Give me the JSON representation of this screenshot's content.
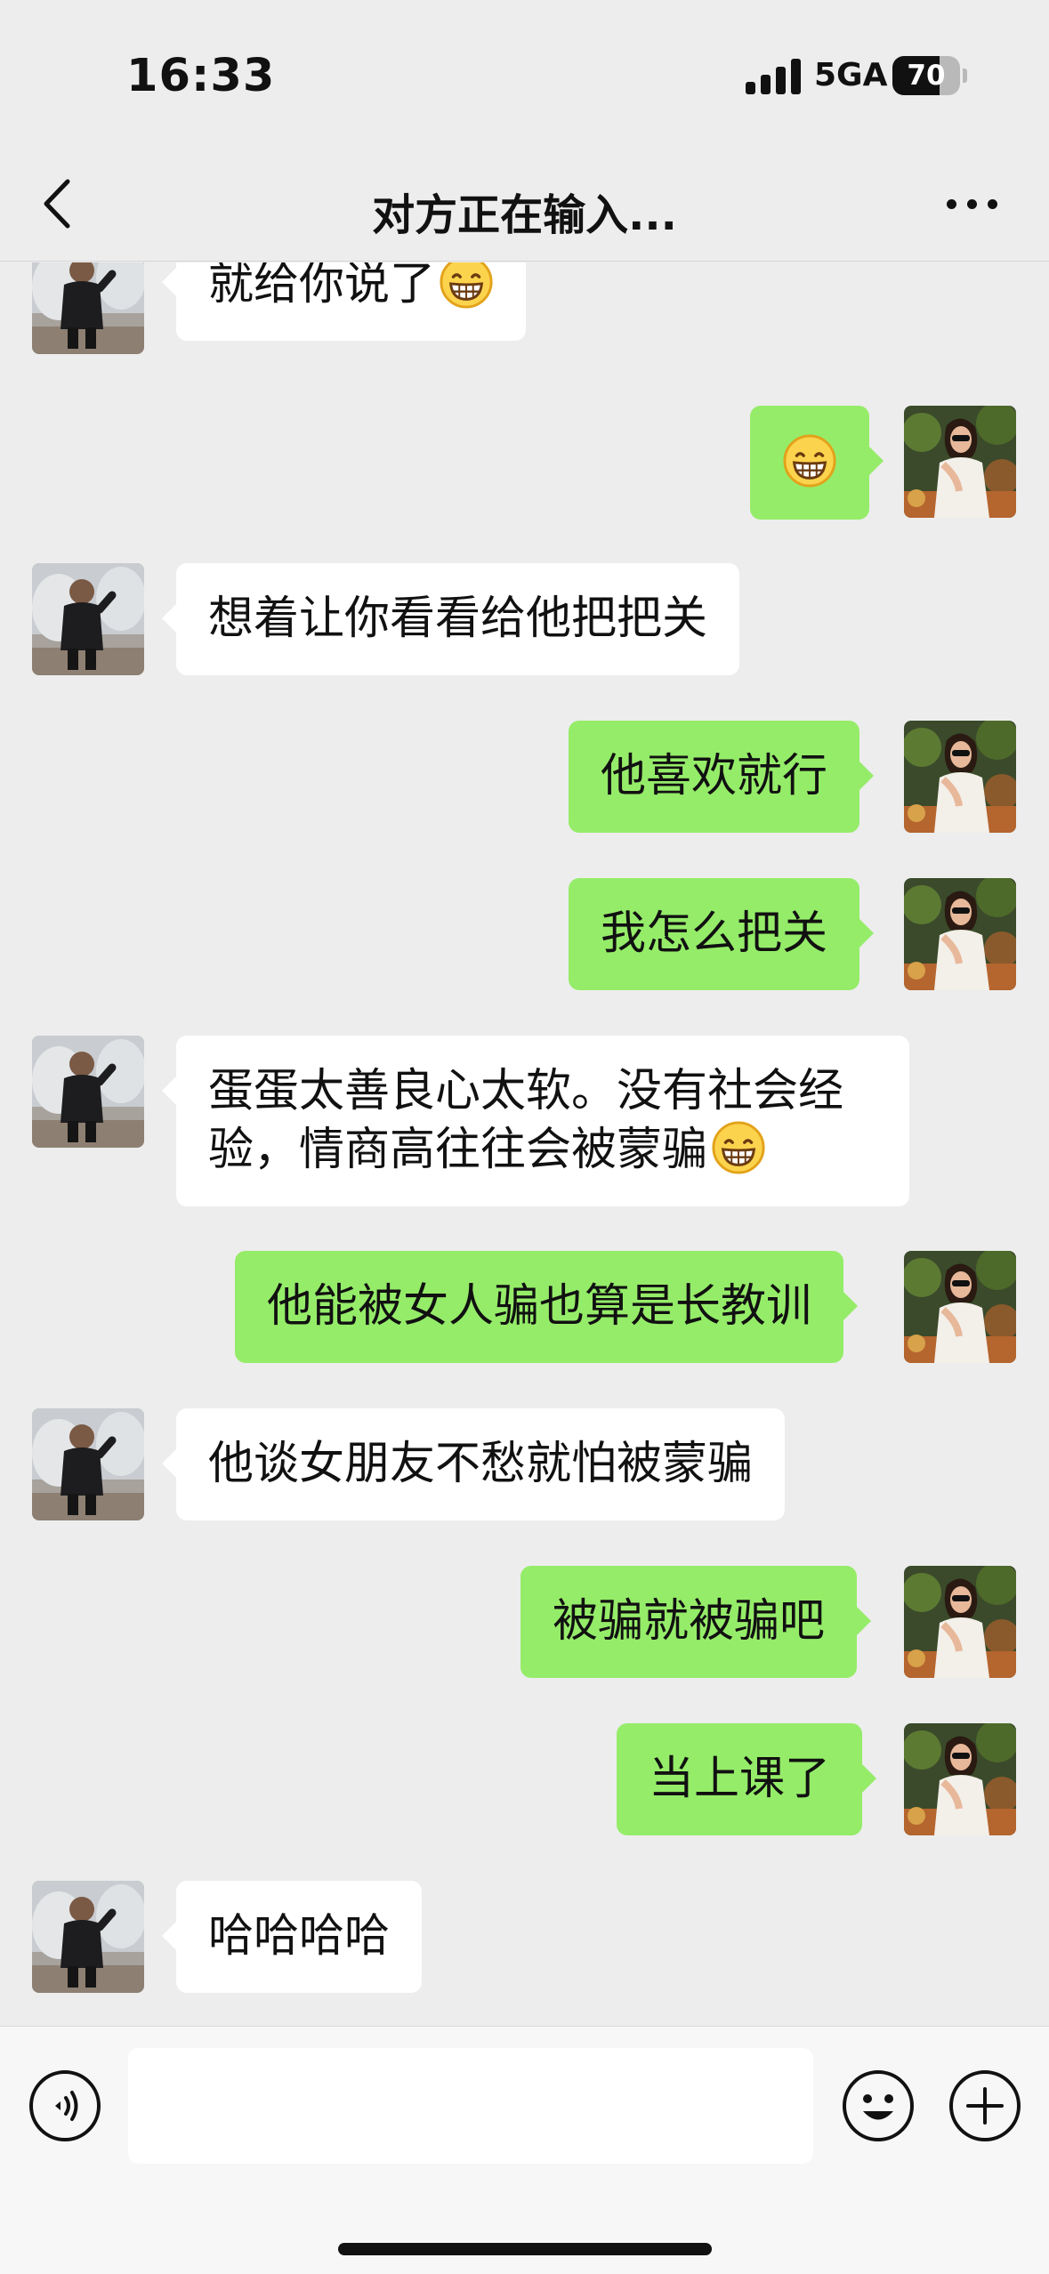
{
  "status_bar": {
    "time": "16:33",
    "network": "5GA",
    "battery": "70",
    "battery_level": 0.7
  },
  "nav": {
    "title": "对方正在输入..."
  },
  "messages": [
    {
      "side": "in",
      "text": "就给你说了",
      "emoji": "grin-emoji"
    },
    {
      "side": "out",
      "text": "",
      "emoji": "grin-emoji"
    },
    {
      "side": "in",
      "text": "想着让你看看给他把把关"
    },
    {
      "side": "out",
      "text": "他喜欢就行"
    },
    {
      "side": "out",
      "text": "我怎么把关"
    },
    {
      "side": "in",
      "text": "蛋蛋太善良心太软。没有社会经验，情商高往往会被蒙骗",
      "emoji": "grin-emoji"
    },
    {
      "side": "out",
      "text": "他能被女人骗也算是长教训"
    },
    {
      "side": "in",
      "text": "他谈女朋友不愁就怕被蒙骗"
    },
    {
      "side": "out",
      "text": "被骗就被骗吧"
    },
    {
      "side": "out",
      "text": "当上课了"
    },
    {
      "side": "in",
      "text": "哈哈哈哈"
    }
  ],
  "input": {
    "value": "",
    "placeholder": ""
  },
  "colors": {
    "background": "#ededed",
    "incoming_bubble": "#ffffff",
    "outgoing_bubble": "#95ec69"
  }
}
